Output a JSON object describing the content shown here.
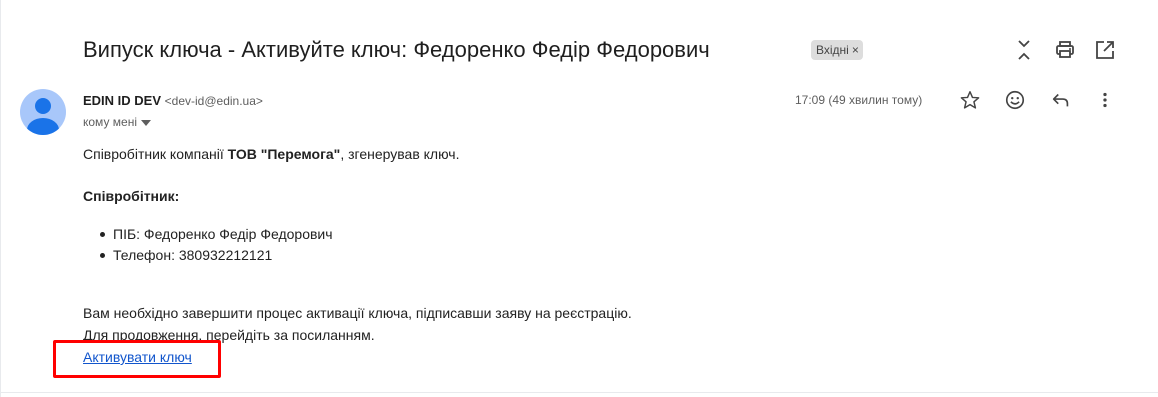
{
  "subject": "Випуск ключа - Активуйте ключ: Федоренко Федір Федорович",
  "label_chip": {
    "text": "Вхідні",
    "remove": "×"
  },
  "sender": {
    "name": "EDIN ID DEV",
    "email": "<dev-id@edin.ua>",
    "to": "кому мені",
    "timestamp": "17:09 (49 хвилин тому)"
  },
  "body": {
    "intro_prefix": "Співробітник компанії ",
    "company": "ТОВ \"Перемога\"",
    "intro_suffix": ", згенерував ключ.",
    "employee_heading": "Співробітник:",
    "details": [
      "ПІБ: Федоренко Федір Федорович",
      "Телефон: 380932212121"
    ],
    "instruction": "Вам необхідно завершити процес активації ключа, підписавши заяву на реєстрацію.",
    "continue": "Для продовження, перейдіть за посиланням.",
    "link_text": "Активувати ключ"
  },
  "icons": {
    "top": [
      "collapse-icon",
      "print-icon",
      "open-in-new-window-icon"
    ],
    "actions": [
      "star-icon",
      "emoji-icon",
      "reply-icon",
      "more-vert-icon"
    ]
  },
  "colors": {
    "link": "#1155cc",
    "highlight": "#ff0000",
    "avatar": "#a8c7fa",
    "avatar_figure": "#1a73e8"
  }
}
